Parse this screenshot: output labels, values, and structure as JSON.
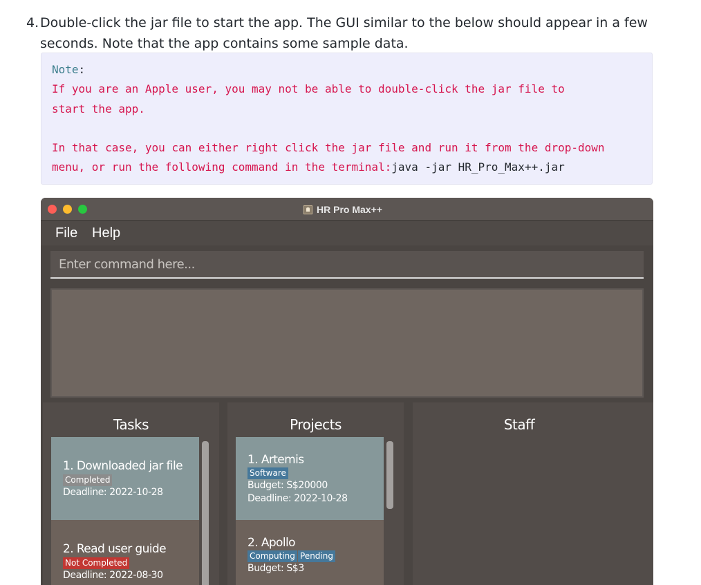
{
  "instructions": {
    "step_number": "4.",
    "line1": "Double-click the jar file to start the app. The GUI similar to the below should appear in a few",
    "line2": "seconds. Note that the app contains some sample data."
  },
  "note": {
    "label": "Note",
    "colon": ":",
    "line1": "If you are an Apple user, you may not be able to double-click the jar file to",
    "line2": "start the app.",
    "line3": "In that case, you can either right click the jar file and run it from the drop-down",
    "line4_prefix": "menu, or run the following command in the terminal:",
    "command": "java -jar HR_Pro_Max++.jar"
  },
  "window": {
    "title": "HR Pro Max++",
    "icon": "app-icon",
    "controls": [
      "close",
      "minimize",
      "zoom"
    ],
    "colors": {
      "close": "#fe5f57",
      "minimize": "#febc2e",
      "zoom": "#28c840"
    }
  },
  "menu": {
    "file": "File",
    "help": "Help"
  },
  "command_box": {
    "placeholder": "Enter command here...",
    "value": ""
  },
  "result_display": {
    "text": ""
  },
  "panels": {
    "tasks": {
      "header": "Tasks",
      "items": [
        {
          "title": "1.  Downloaded jar file",
          "status": "Completed",
          "status_color": "grey",
          "deadline": "Deadline: 2022-10-28",
          "selected": true
        },
        {
          "title": "2.  Read user guide",
          "status": "Not Completed",
          "status_color": "red",
          "deadline": "Deadline: 2022-08-30",
          "selected": false
        }
      ]
    },
    "projects": {
      "header": "Projects",
      "items": [
        {
          "title": "1.  Artemis",
          "tags": [
            "Software"
          ],
          "budget": "Budget: S$20000",
          "deadline": "Deadline: 2022-10-28",
          "selected": true
        },
        {
          "title": "2.  Apollo",
          "tags": [
            "Computing",
            "Pending"
          ],
          "budget": "Budget: S$3",
          "selected": false
        }
      ]
    },
    "staff": {
      "header": "Staff",
      "items": []
    }
  }
}
